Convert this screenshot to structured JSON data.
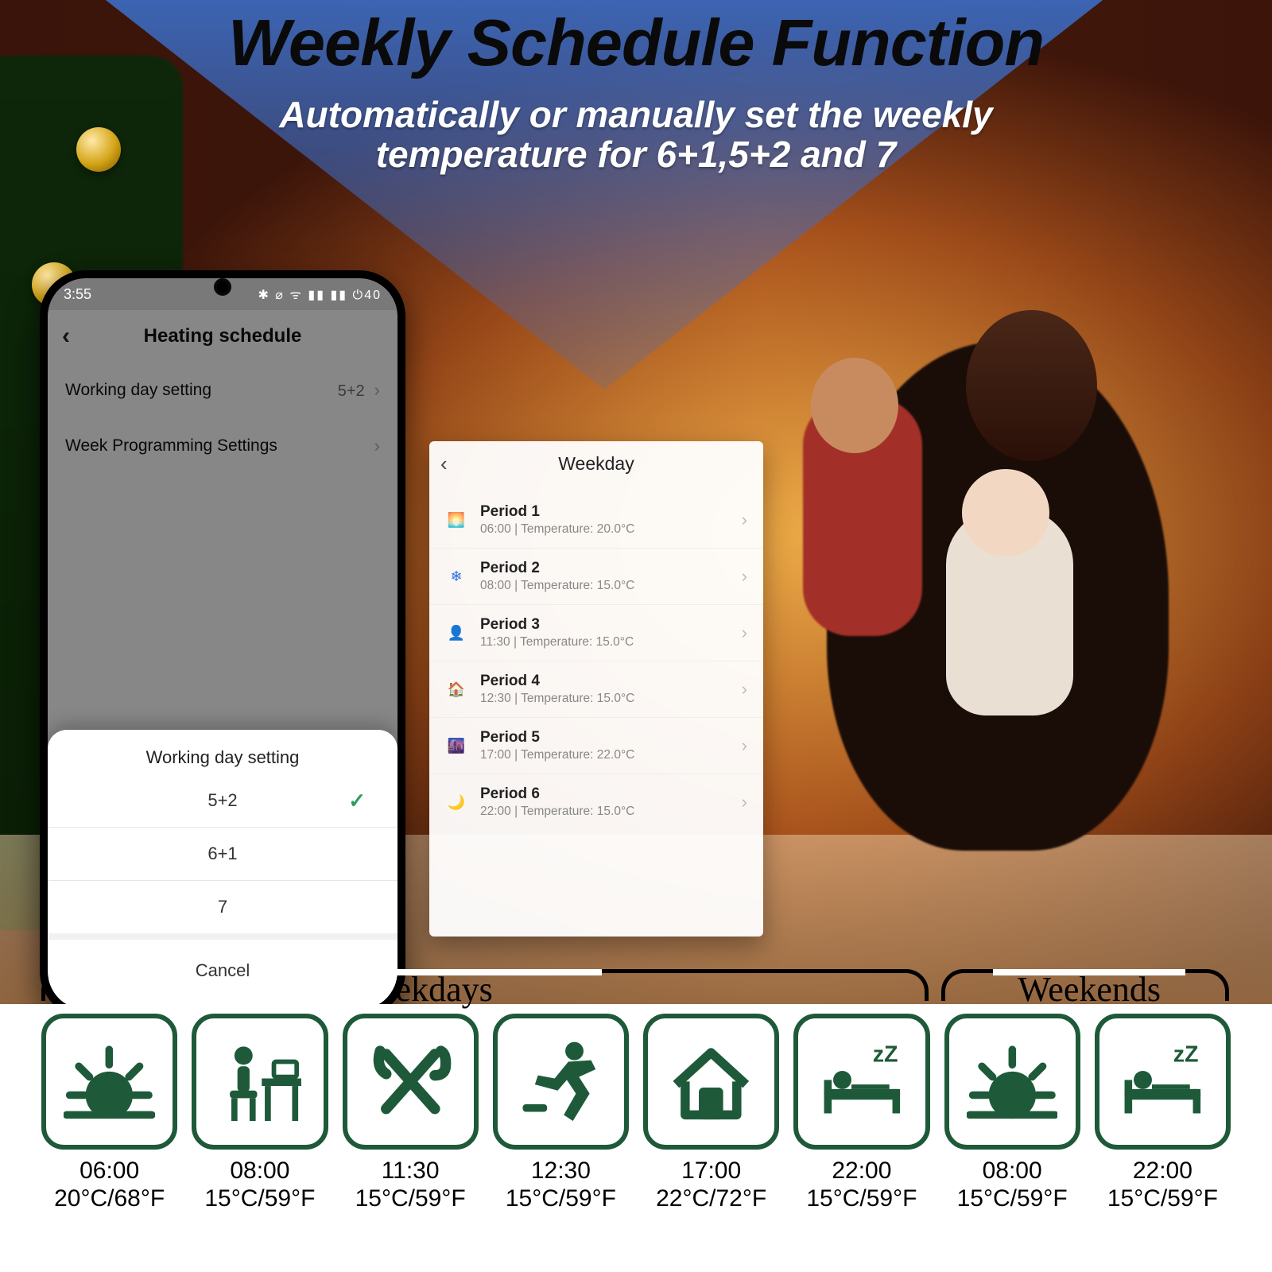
{
  "banner": {
    "title": "Weekly Schedule Function",
    "subtitle_l1": "Automatically or manually set the weekly",
    "subtitle_l2": "temperature for 6+1,5+2 and 7"
  },
  "phone1": {
    "status_time": "3:55",
    "status_right": "✱ ⌀ ᯤ ▮▮ ▮▮ ⏻40",
    "title": "Heating schedule",
    "rows": [
      {
        "label": "Working day setting",
        "value": "5+2"
      },
      {
        "label": "Week Programming Settings",
        "value": ""
      }
    ],
    "sheet": {
      "title": "Working day setting",
      "options": [
        "5+2",
        "6+1",
        "7"
      ],
      "selected": "5+2",
      "cancel": "Cancel"
    }
  },
  "phone2": {
    "title": "Weekday",
    "periods": [
      {
        "icon": "🌅",
        "color": "#2e9d5b",
        "name": "Period 1",
        "detail": "06:00  |  Temperature: 20.0°C"
      },
      {
        "icon": "❄",
        "color": "#2d6cdf",
        "name": "Period 2",
        "detail": "08:00  |  Temperature: 15.0°C"
      },
      {
        "icon": "👤",
        "color": "#e2b400",
        "name": "Period 3",
        "detail": "11:30  |  Temperature: 15.0°C"
      },
      {
        "icon": "🏠",
        "color": "#e24a3b",
        "name": "Period 4",
        "detail": "12:30  |  Temperature: 15.0°C"
      },
      {
        "icon": "🌆",
        "color": "#c74b8a",
        "name": "Period 5",
        "detail": "17:00  |  Temperature: 22.0°C"
      },
      {
        "icon": "🌙",
        "color": "#5a8bd8",
        "name": "Period 6",
        "detail": "22:00  |  Temperature: 15.0°C"
      }
    ]
  },
  "strip": {
    "label_weekdays": "Weekdays",
    "label_weekends": "Weekends",
    "tiles": [
      {
        "icon": "sunrise",
        "time": "06:00",
        "temp": "20°C/68°F"
      },
      {
        "icon": "desk",
        "time": "08:00",
        "temp": "15°C/59°F"
      },
      {
        "icon": "meal",
        "time": "11:30",
        "temp": "15°C/59°F"
      },
      {
        "icon": "run",
        "time": "12:30",
        "temp": "15°C/59°F"
      },
      {
        "icon": "home",
        "time": "17:00",
        "temp": "22°C/72°F"
      },
      {
        "icon": "sleep",
        "time": "22:00",
        "temp": "15°C/59°F"
      },
      {
        "icon": "sunrise",
        "time": "08:00",
        "temp": "15°C/59°F"
      },
      {
        "icon": "sleep",
        "time": "22:00",
        "temp": "15°C/59°F"
      }
    ]
  },
  "icon_stroke": "#1e5a3a"
}
